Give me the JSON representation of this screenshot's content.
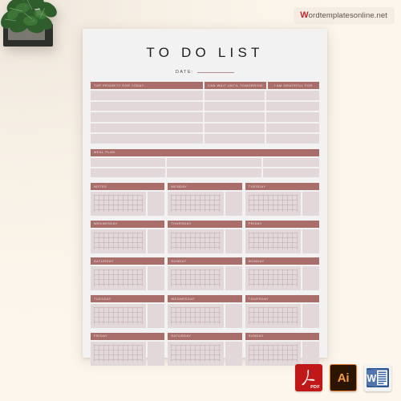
{
  "watermark": {
    "brand_w": "W",
    "text": "ordtemplatesonline.net",
    "color": "#c0272d"
  },
  "decoration": {
    "plant": "potted-plant"
  },
  "sheet": {
    "title": "TO DO LIST",
    "date_label": "DATE:",
    "background": "#f2f2f2",
    "accent_header": "#a96e6a",
    "accent_fill": "#e3d8d9"
  },
  "priority_table": {
    "headers": [
      "TOP PRIORITY FOR TODAY:",
      "CAN WAIT UNTIL TOMORROW",
      "I AM GRATEFUL FOR"
    ],
    "row_count": 5
  },
  "meal_plan": {
    "header": "MEAL PLAN",
    "row_count": 2,
    "column_count": 3
  },
  "day_grid": {
    "rows": [
      [
        "NOTES",
        "MONDAY",
        "TUESDAY"
      ],
      [
        "WEDNESDAY",
        "THURSDAY",
        "FRIDAY"
      ],
      [
        "SATURDAY",
        "SUNDAY",
        "MONDAY"
      ],
      [
        "TUESDAY",
        "WEDNESDAY",
        "THURSDAY"
      ],
      [
        "FRIDAY",
        "SATURDAY",
        "SUNDAY"
      ]
    ]
  },
  "file_formats": [
    {
      "id": "pdf",
      "label": "PDF",
      "color": "#c01818"
    },
    {
      "id": "ai",
      "label": "Ai",
      "color": "#2b1500"
    },
    {
      "id": "word",
      "label": "W",
      "color": "#2b579a"
    }
  ]
}
